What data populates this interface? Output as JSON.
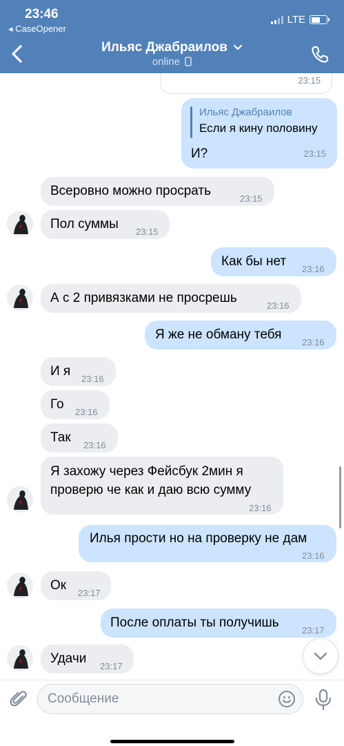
{
  "status_bar": {
    "time": "23:46",
    "back_app": "◂ CaseOpener",
    "network": "LTE"
  },
  "header": {
    "title": "Ильяс Джабраилов",
    "status": "online"
  },
  "messages": [
    {
      "dir": "out",
      "time": "23:15",
      "partial_sticker": true
    },
    {
      "dir": "out",
      "reply_name": "Ильяс Джабраилов",
      "reply_text": "Если я кину половину",
      "text": "И?",
      "time": "23:15"
    },
    {
      "dir": "in",
      "text": "Всеровно можно просрать",
      "time": "23:15"
    },
    {
      "dir": "in",
      "text": "Пол суммы",
      "time": "23:15"
    },
    {
      "dir": "out",
      "text": "Как бы нет",
      "time": "23:16"
    },
    {
      "dir": "in",
      "text": "А с 2 привязками не просрешь",
      "time": "23:16"
    },
    {
      "dir": "out",
      "text": "Я же не обману тебя",
      "time": "23:16"
    },
    {
      "dir": "in",
      "text": "И я",
      "time": "23:16"
    },
    {
      "dir": "in",
      "text": "Го",
      "time": "23:16"
    },
    {
      "dir": "in",
      "text": "Так",
      "time": "23:16"
    },
    {
      "dir": "in",
      "line1": "Я захожу через Фейсбук 2мин я",
      "line2": "проверю че как и даю всю сумму",
      "time": "23:16"
    },
    {
      "dir": "out",
      "text": "Илья прости но на проверку не дам",
      "time": "23:16"
    },
    {
      "dir": "in",
      "text": "Ок",
      "time": "23:17"
    },
    {
      "dir": "out",
      "text": "После оплаты ты получишь",
      "time": "23:17"
    },
    {
      "dir": "in",
      "text": "Удачи",
      "time": "23:17"
    }
  ],
  "composer": {
    "placeholder": "Сообщение"
  },
  "colors": {
    "header": "#5181b8",
    "incoming_bubble": "#ebedf0",
    "outgoing_bubble": "#cce4ff",
    "time": "#818c99"
  },
  "icons": {
    "back": "chevron-left-icon",
    "call": "phone-icon",
    "attach": "paperclip-icon",
    "emoji": "smile-icon",
    "voice": "microphone-icon",
    "scroll": "chevron-down-icon"
  }
}
